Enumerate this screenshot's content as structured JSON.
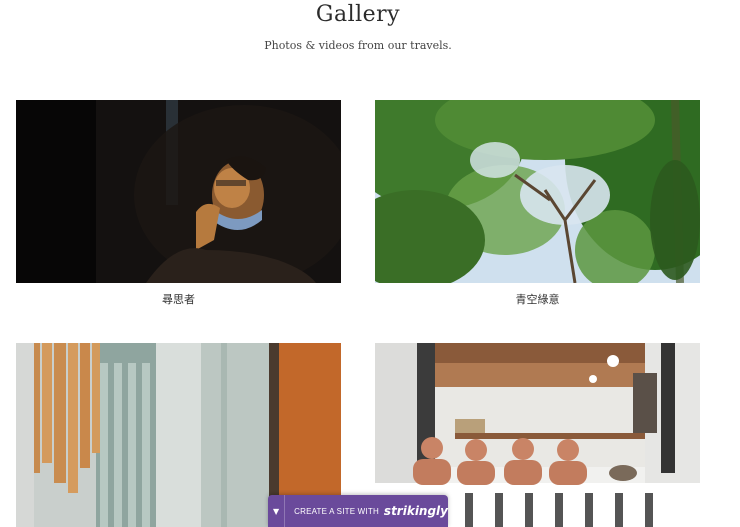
{
  "gallery": {
    "title": "Gallery",
    "subtitle": "Photos & videos from our travels."
  },
  "items": [
    {
      "caption": "尋思者"
    },
    {
      "caption": "青空綠意"
    },
    {
      "caption": ""
    },
    {
      "caption": ""
    }
  ],
  "badge": {
    "label": "CREATE A SITE WITH",
    "brand": "strikingly",
    "icon": "chevron-down-icon"
  },
  "colors": {
    "badge": "#6a4a9b"
  }
}
